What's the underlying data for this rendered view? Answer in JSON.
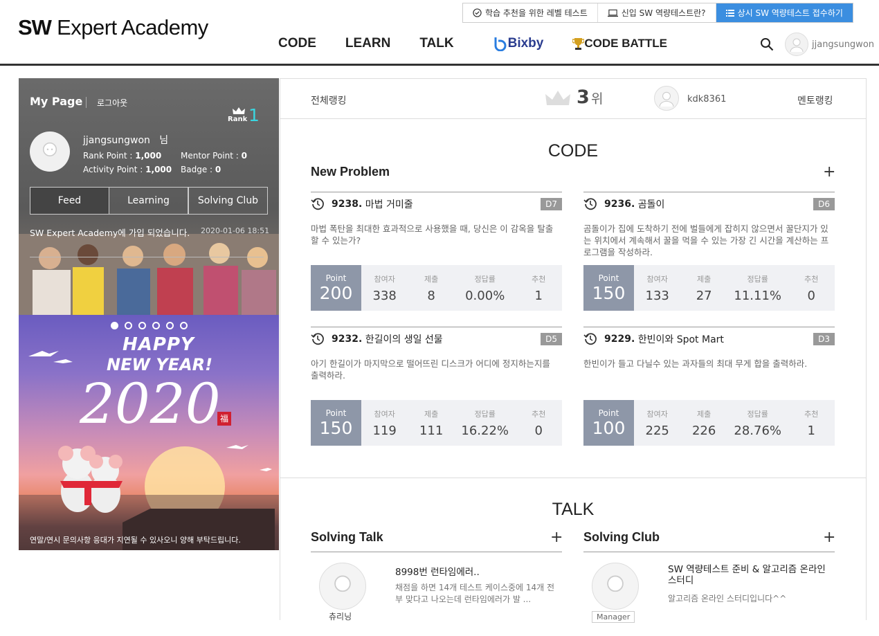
{
  "header": {
    "logo_sw": "SW",
    "logo_rest": "Expert Academy",
    "top_links": [
      "학습 추천을 위한 레벨 테스트",
      "신입 SW 역량테스트란?",
      "상시 SW 역량테스트 접수하기"
    ],
    "nav": [
      "CODE",
      "LEARN",
      "TALK",
      "Bixby",
      "CODE BATTLE"
    ],
    "username": "jjangsungwon"
  },
  "mypage": {
    "title": "My Page",
    "logout": "로그아웃",
    "rank_label": "Rank",
    "rank_value": "1",
    "username": "jjangsungwon",
    "honorific": "님",
    "rank_point_label": "Rank Point : ",
    "rank_point": "1,000",
    "mentor_point_label": "Mentor Point : ",
    "mentor_point": "0",
    "activity_point_label": "Activity Point : ",
    "activity_point": "1,000",
    "badge_label": "Badge : ",
    "badge": "0",
    "tabs": [
      "Feed",
      "Learning",
      "Solving Club"
    ],
    "feed_text": "SW Expert Academy에 가입 되었습니다.",
    "feed_time": "2020-01-06 18:51"
  },
  "banner": {
    "happy": "HAPPY",
    "newyear": "NEW YEAR!",
    "year": "2020",
    "fu": "福",
    "notice": "연말/연시 문의사항 응대가 지연될 수 있사오니 양해 부탁드립니다."
  },
  "rankbar": {
    "overall": "전체랭킹",
    "rank": "3",
    "rank_unit": "위",
    "top_user": "kdk8361",
    "mentor": "멘토랭킹"
  },
  "code": {
    "section": "CODE",
    "sub": "New Problem",
    "plus": "+",
    "stat_labels": [
      "참여자",
      "제출",
      "정답률",
      "추천"
    ],
    "point_label": "Point",
    "problems": [
      {
        "num": "9238.",
        "title": "마법 거미줄",
        "level": "D7",
        "desc": "마법 폭탄을 최대한 효과적으로 사용했을 때, 당신은 이 감옥을 탈출할 수 있는가?",
        "point": "200",
        "participants": "338",
        "submits": "8",
        "rate": "0.00%",
        "recommend": "1"
      },
      {
        "num": "9236.",
        "title": "곰돌이",
        "level": "D6",
        "desc": "곰돌이가 집에 도착하기 전에 벌들에게 잡히지 않으면서 꿀단지가 있는 위치에서 계속해서 꿀을 먹을 수 있는 가장 긴 시간을 계산하는 프로그램을 작성하라.",
        "point": "150",
        "participants": "133",
        "submits": "27",
        "rate": "11.11%",
        "recommend": "0"
      },
      {
        "num": "9232.",
        "title": "한길이의 생일 선물",
        "level": "D5",
        "desc": "아기 한길이가 마지막으로 떨어뜨린 디스크가 어디에 정지하는지를 출력하라.",
        "point": "150",
        "participants": "119",
        "submits": "111",
        "rate": "16.22%",
        "recommend": "0"
      },
      {
        "num": "9229.",
        "title": "한빈이와 Spot Mart",
        "level": "D3",
        "desc": "한빈이가 들고 다닐수 있는 과자들의 최대 무게 합을 출력하라.",
        "point": "100",
        "participants": "225",
        "submits": "226",
        "rate": "28.76%",
        "recommend": "1"
      }
    ]
  },
  "talk": {
    "section": "TALK",
    "solving_talk": "Solving Talk",
    "solving_club": "Solving Club",
    "talk_title": "8998번 런타임에러..",
    "talk_body": "채점을 하면 14개 테스트 케이스중에 14개 전부 맞다고 나오는데 런타임에러가 발 ...",
    "talk_user": "츄리닝",
    "club_title": "SW 역량테스트 준비 & 알고리즘 온라인 스터디",
    "club_body": "알고리즘 온라인 스터디입니다^^",
    "club_role": "Manager"
  },
  "colors": {
    "accent": "#3b8ee0",
    "rank_cyan": "#3ad6e0",
    "point_bg": "#8e97a8",
    "stat_bg": "#f0f1f4"
  }
}
